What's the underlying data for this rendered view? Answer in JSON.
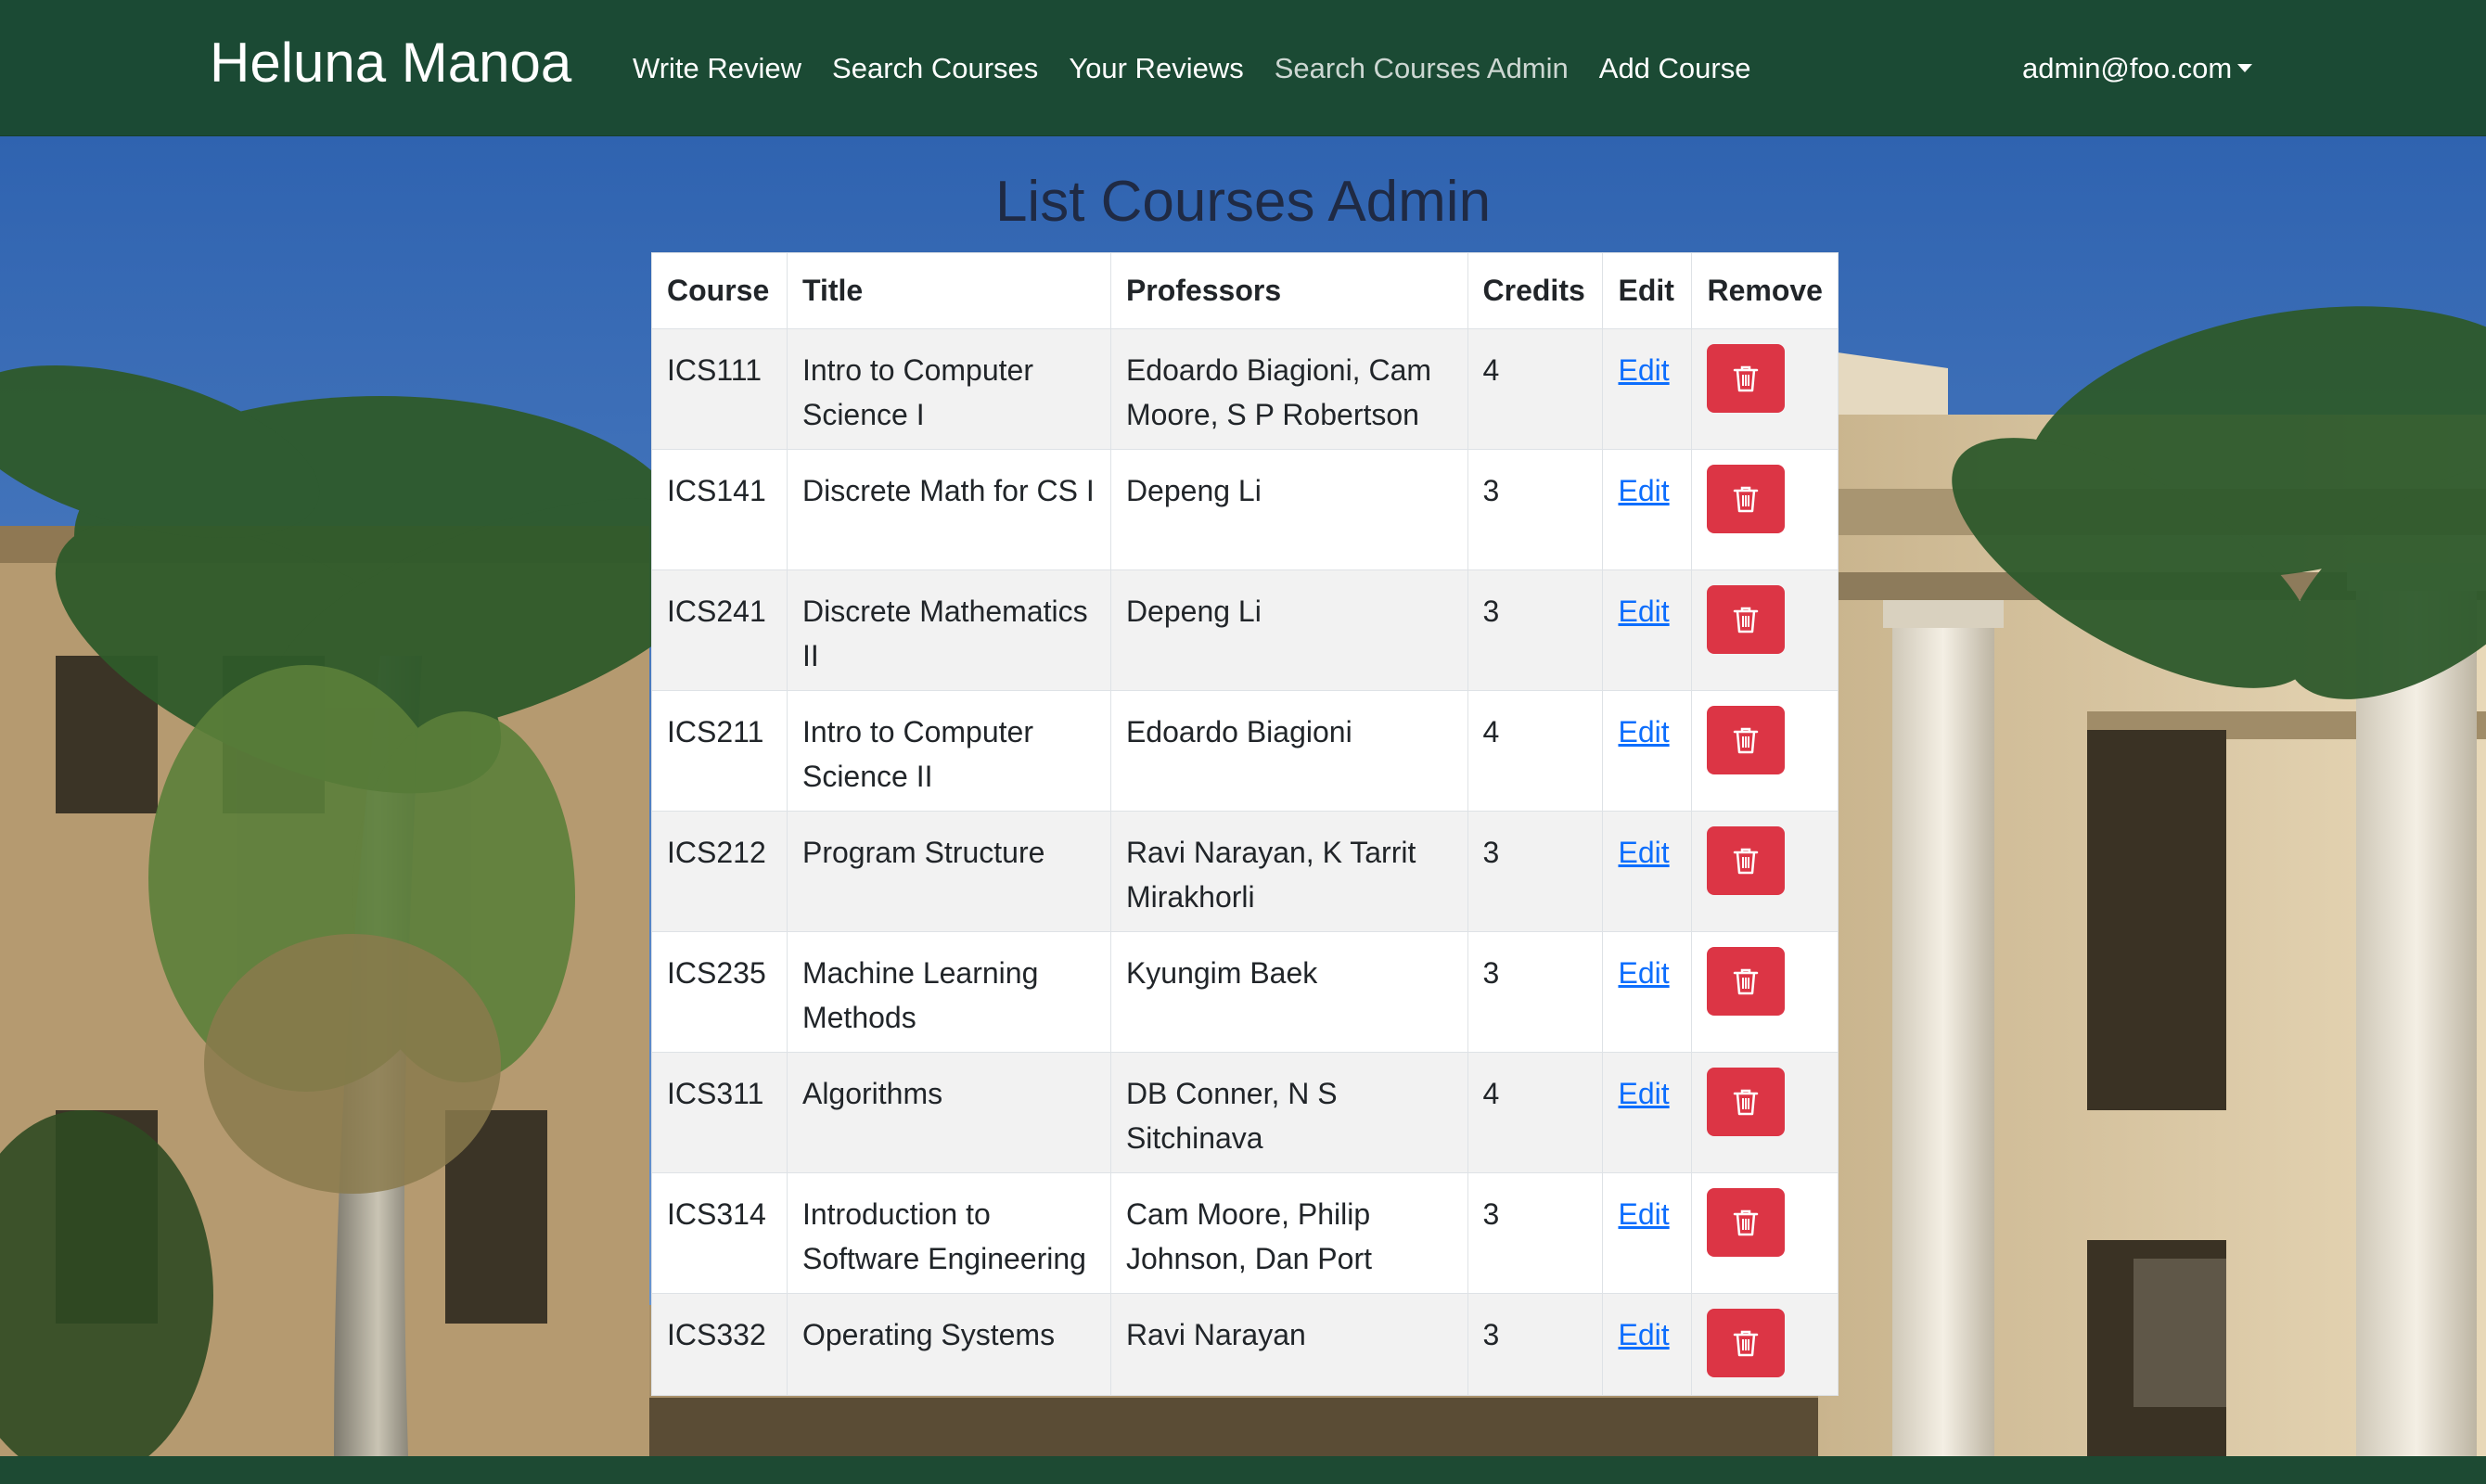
{
  "brand": "Heluna Manoa",
  "nav": {
    "links": [
      {
        "label": "Write Review"
      },
      {
        "label": "Search Courses"
      },
      {
        "label": "Your Reviews"
      },
      {
        "label": "Search Courses Admin",
        "active": true
      },
      {
        "label": "Add Course"
      }
    ],
    "user": "admin@foo.com",
    "user_caret_icon": "caret-down-icon"
  },
  "page_title": "List Courses Admin",
  "table": {
    "headers": [
      "Course",
      "Title",
      "Professors",
      "Credits",
      "Edit",
      "Remove"
    ],
    "rows": [
      {
        "course": "ICS111",
        "title": "Intro to Computer Science I",
        "professors": "Edoardo Biagioni, Cam Moore, S P Robertson",
        "credits": "4",
        "edit": "Edit"
      },
      {
        "course": "ICS141",
        "title": "Discrete Math for CS I",
        "professors": "Depeng Li",
        "credits": "3",
        "edit": "Edit"
      },
      {
        "course": "ICS241",
        "title": "Discrete Mathematics II",
        "professors": "Depeng Li",
        "credits": "3",
        "edit": "Edit"
      },
      {
        "course": "ICS211",
        "title": "Intro to Computer Science II",
        "professors": "Edoardo Biagioni",
        "credits": "4",
        "edit": "Edit"
      },
      {
        "course": "ICS212",
        "title": "Program Structure",
        "professors": "Ravi Narayan, K Tarrit Mirakhorli",
        "credits": "3",
        "edit": "Edit"
      },
      {
        "course": "ICS235",
        "title": "Machine Learning Methods",
        "professors": "Kyungim Baek",
        "credits": "3",
        "edit": "Edit"
      },
      {
        "course": "ICS311",
        "title": "Algorithms",
        "professors": "DB Conner, N S Sitchinava",
        "credits": "4",
        "edit": "Edit"
      },
      {
        "course": "ICS314",
        "title": "Introduction to Software Engineering",
        "professors": "Cam Moore, Philip Johnson, Dan Port",
        "credits": "3",
        "edit": "Edit"
      },
      {
        "course": "ICS332",
        "title": "Operating Systems",
        "professors": "Ravi Narayan",
        "credits": "3",
        "edit": "Edit"
      }
    ],
    "remove_icon": "trash-icon"
  },
  "colors": {
    "navbar": "#1b4a34",
    "title_text": "#1f2a44",
    "edit_link": "#0d6efd",
    "remove_button": "#dc3545"
  }
}
